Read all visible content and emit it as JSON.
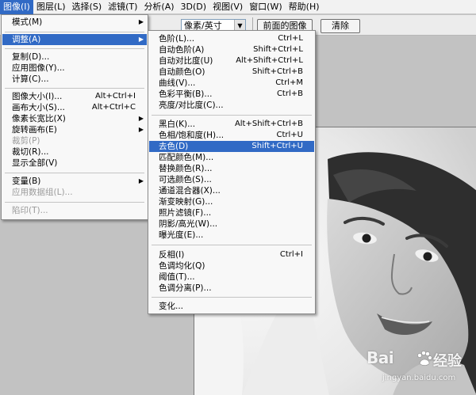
{
  "menubar": {
    "items": [
      {
        "label": "图像(I)"
      },
      {
        "label": "图层(L)"
      },
      {
        "label": "选择(S)"
      },
      {
        "label": "滤镜(T)"
      },
      {
        "label": "分析(A)"
      },
      {
        "label": "3D(D)"
      },
      {
        "label": "视图(V)"
      },
      {
        "label": "窗口(W)"
      },
      {
        "label": "帮助(H)"
      }
    ]
  },
  "options": {
    "unit_value": "像素/英寸",
    "front_image_label": "前面的图像",
    "clear_label": "清除"
  },
  "image_menu": {
    "items": [
      {
        "label": "模式(M)",
        "submenu": true
      },
      {
        "label": "调整(A)",
        "submenu": true,
        "active": true
      },
      {
        "label": "复制(D)..."
      },
      {
        "label": "应用图像(Y)..."
      },
      {
        "label": "计算(C)..."
      },
      {
        "label": "图像大小(I)...",
        "shortcut": "Alt+Ctrl+I"
      },
      {
        "label": "画布大小(S)...",
        "shortcut": "Alt+Ctrl+C"
      },
      {
        "label": "像素长宽比(X)",
        "submenu": true
      },
      {
        "label": "旋转画布(E)",
        "submenu": true
      },
      {
        "label": "裁剪(P)",
        "disabled": true
      },
      {
        "label": "裁切(R)..."
      },
      {
        "label": "显示全部(V)"
      },
      {
        "label": "变量(B)",
        "submenu": true
      },
      {
        "label": "应用数据组(L)...",
        "disabled": true
      },
      {
        "label": "陷印(T)...",
        "disabled": true
      }
    ]
  },
  "adjust_menu": {
    "items": [
      {
        "label": "色阶(L)...",
        "shortcut": "Ctrl+L"
      },
      {
        "label": "自动色阶(A)",
        "shortcut": "Shift+Ctrl+L"
      },
      {
        "label": "自动对比度(U)",
        "shortcut": "Alt+Shift+Ctrl+L"
      },
      {
        "label": "自动颜色(O)",
        "shortcut": "Shift+Ctrl+B"
      },
      {
        "label": "曲线(V)...",
        "shortcut": "Ctrl+M"
      },
      {
        "label": "色彩平衡(B)...",
        "shortcut": "Ctrl+B"
      },
      {
        "label": "亮度/对比度(C)..."
      },
      {
        "label": "黑白(K)...",
        "shortcut": "Alt+Shift+Ctrl+B"
      },
      {
        "label": "色相/饱和度(H)...",
        "shortcut": "Ctrl+U"
      },
      {
        "label": "去色(D)",
        "shortcut": "Shift+Ctrl+U",
        "active": true
      },
      {
        "label": "匹配颜色(M)..."
      },
      {
        "label": "替换颜色(R)..."
      },
      {
        "label": "可选颜色(S)..."
      },
      {
        "label": "通道混合器(X)..."
      },
      {
        "label": "渐变映射(G)..."
      },
      {
        "label": "照片滤镜(F)..."
      },
      {
        "label": "阴影/高光(W)..."
      },
      {
        "label": "曝光度(E)..."
      },
      {
        "label": "反相(I)",
        "shortcut": "Ctrl+I"
      },
      {
        "label": "色调均化(Q)"
      },
      {
        "label": "阈值(T)..."
      },
      {
        "label": "色调分离(P)..."
      },
      {
        "label": "变化..."
      }
    ]
  },
  "watermark": {
    "brand_left": "Bai",
    "brand_right": "经验",
    "url": "jingyan.baidu.com"
  },
  "colors": {
    "highlight": "#316ac5",
    "menu_bg": "#f8f8f8",
    "workspace": "#c2c2c2"
  }
}
